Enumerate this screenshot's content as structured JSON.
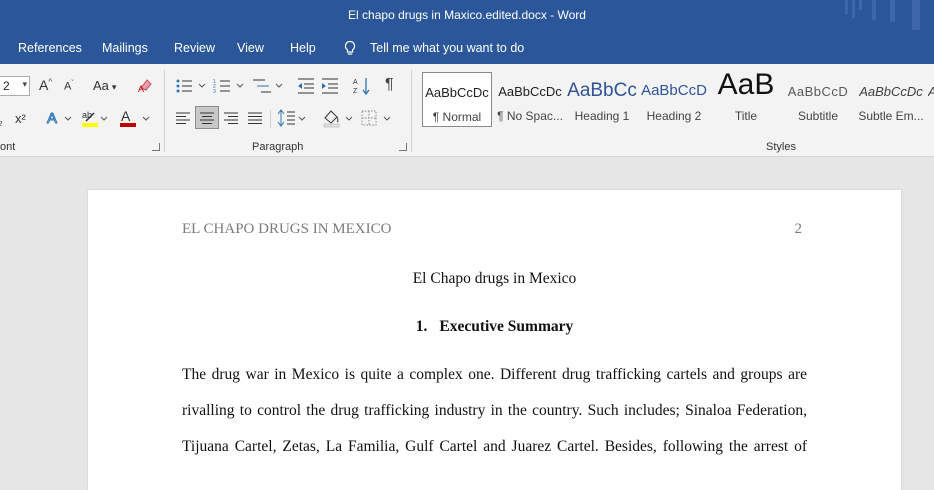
{
  "window": {
    "title": "El chapo drugs in Maxico.edited.docx  -  Word"
  },
  "menu": {
    "items": [
      "References",
      "Mailings",
      "Review",
      "View",
      "Help"
    ],
    "tell_me": "Tell me what you want to do"
  },
  "ribbon": {
    "font": {
      "size_value": "2",
      "case_label": "Aa",
      "superscript": "x²",
      "subscript": "₂",
      "group_label": "ont"
    },
    "paragraph": {
      "group_label": "Paragraph"
    },
    "styles": {
      "group_label": "Styles",
      "items": [
        {
          "sample": "AaBbCcDc",
          "name": "¶ Normal"
        },
        {
          "sample": "AaBbCcDc",
          "name": "¶ No Spac..."
        },
        {
          "sample": "AaBbCc",
          "name": "Heading 1"
        },
        {
          "sample": "AaBbCcD",
          "name": "Heading 2"
        },
        {
          "sample": "AaB",
          "name": "Title"
        },
        {
          "sample": "AaBbCcD",
          "name": "Subtitle"
        },
        {
          "sample": "AaBbCcDc",
          "name": "Subtle Em..."
        }
      ],
      "accent_colors": {
        "heading": "#2f5496",
        "subtitle": "#595959"
      }
    }
  },
  "document": {
    "running_head": "EL CHAPO DRUGS IN MEXICO",
    "page_number": "2",
    "title": "El Chapo drugs in Mexico",
    "section_number": "1.",
    "section_title": "Executive Summary",
    "body_lines": [
      "The drug war in Mexico is quite a complex one. Different drug trafficking cartels and groups are",
      "rivalling to control the drug trafficking industry in the country. Such includes; Sinaloa Federation,",
      "Tijuana Cartel, Zetas, La Familia, Gulf Cartel and Juarez Cartel. Besides, following the arrest of"
    ]
  },
  "colors": {
    "title_bar": "#2b579a",
    "ribbon": "#f3f3f3",
    "canvas": "#e6e6e6",
    "font_color_red": "#c00000",
    "highlight_yellow": "#ffff00"
  }
}
